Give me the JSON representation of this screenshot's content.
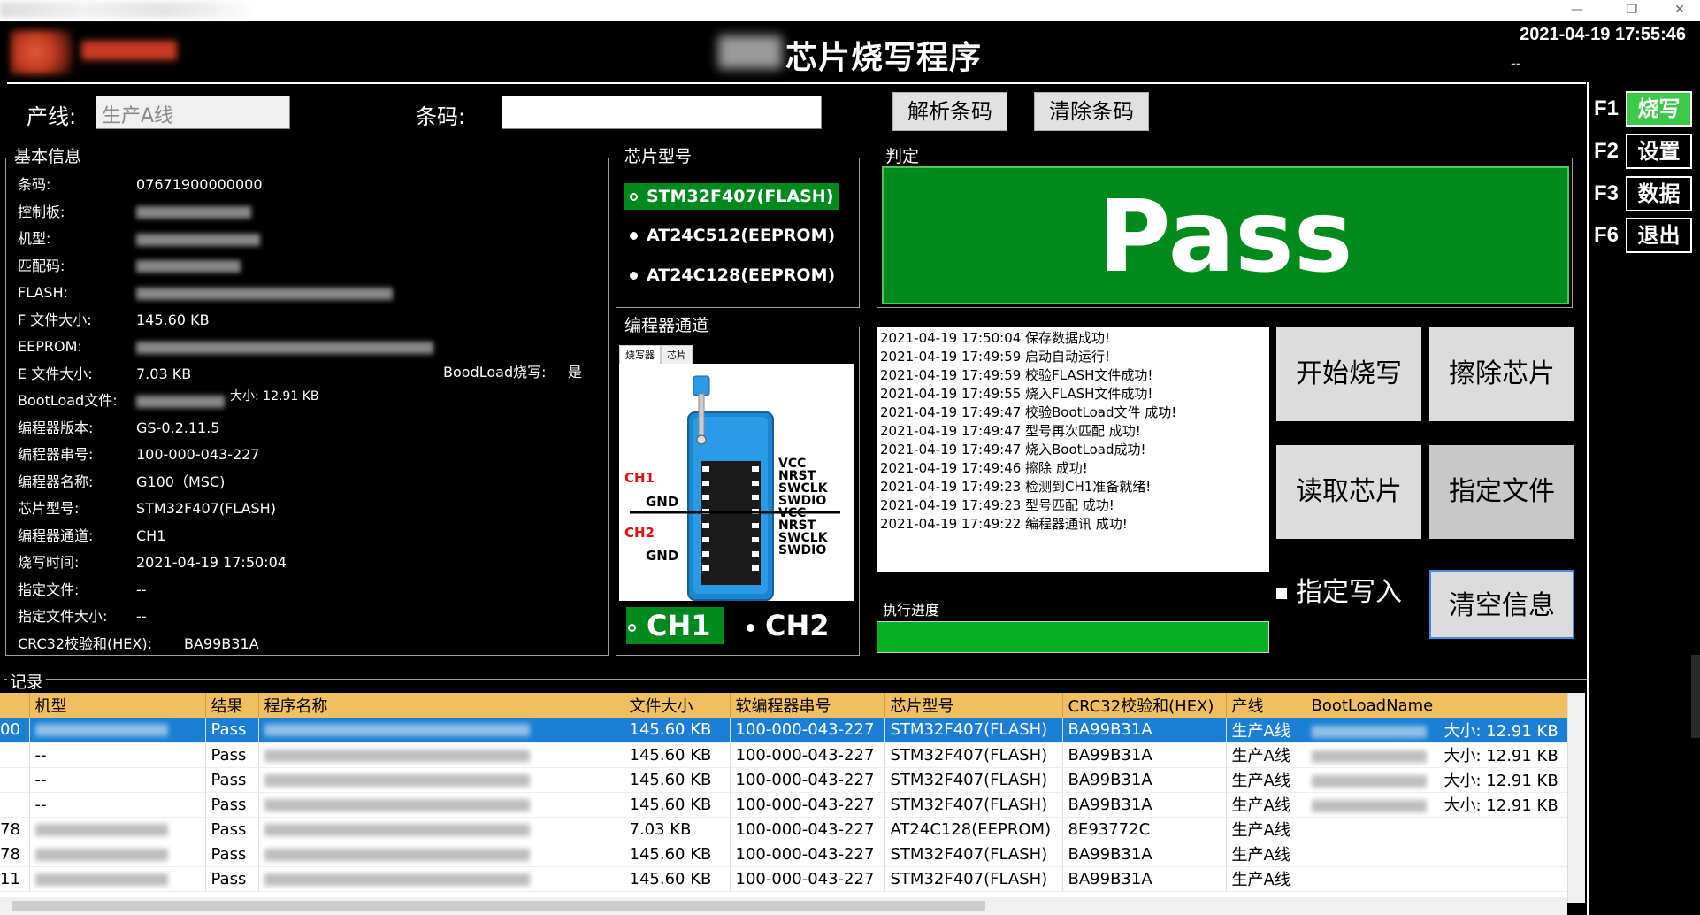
{
  "window": {
    "min": "—",
    "restore": "❐",
    "close": "✕"
  },
  "header": {
    "title": "芯片烧写程序",
    "datetime": "2021-04-19 17:55:46",
    "sub": "--"
  },
  "toolbar": {
    "line_label": "产线:",
    "line_value": "生产A线",
    "barcode_label": "条码:",
    "barcode_value": "",
    "parse_btn": "解析条码",
    "clear_btn": "清除条码"
  },
  "basic_info": {
    "title": "基本信息",
    "rows": [
      {
        "k": "条码:",
        "v": "07671900000000"
      },
      {
        "k": "控制板:",
        "v": ""
      },
      {
        "k": "机型:",
        "v": ""
      },
      {
        "k": "匹配码:",
        "v": ""
      },
      {
        "k": "FLASH:",
        "v": ""
      },
      {
        "k": "F 文件大小:",
        "v": "145.60 KB"
      },
      {
        "k": "EEPROM:",
        "v": ""
      },
      {
        "k": "E 文件大小:",
        "v": "7.03 KB"
      },
      {
        "k": "BootLoad文件:",
        "v": ""
      },
      {
        "k": "编程器版本:",
        "v": "GS-0.2.11.5"
      },
      {
        "k": "编程器串号:",
        "v": "100-000-043-227"
      },
      {
        "k": "编程器名称:",
        "v": "G100（MSC)"
      },
      {
        "k": "芯片型号:",
        "v": "STM32F407(FLASH)"
      },
      {
        "k": "编程器通道:",
        "v": "CH1"
      },
      {
        "k": "烧写时间:",
        "v": "2021-04-19 17:50:04"
      },
      {
        "k": "指定文件:",
        "v": "--"
      },
      {
        "k": "指定文件大小:",
        "v": "--"
      },
      {
        "k": "CRC32校验和(HEX):",
        "v": "BA99B31A"
      }
    ],
    "bootload_burn_label": "BoodLoad烧写:",
    "bootload_burn_value": "是",
    "bootload_size": "大小: 12.91 KB"
  },
  "chip_model": {
    "title": "芯片型号",
    "options": [
      "STM32F407(FLASH)",
      "AT24C512(EEPROM)",
      "AT24C128(EEPROM)"
    ]
  },
  "programmer_channel": {
    "title": "编程器通道",
    "tab1": "烧写器",
    "tab2": "芯片",
    "ch1": "CH1",
    "ch2": "CH2",
    "pins": [
      "VCC",
      "NRST",
      "SWCLK",
      "SWDIO",
      "VCC",
      "NRST",
      "SWCLK",
      "SWDIO"
    ],
    "gnd": "GND",
    "label_ch1": "CH1",
    "label_ch2": "CH2"
  },
  "judge": {
    "title": "判定",
    "result": "Pass"
  },
  "log": [
    {
      "t": "2021-04-19 17:50:04",
      "m": "保存数据成功!"
    },
    {
      "t": "2021-04-19 17:49:59",
      "m": "启动自动运行!"
    },
    {
      "t": "2021-04-19 17:49:59",
      "m": "校验FLASH文件成功!"
    },
    {
      "t": "2021-04-19 17:49:55",
      "m": "烧入FLASH文件成功!"
    },
    {
      "t": "2021-04-19 17:49:47",
      "m": "校验BootLoad文件 成功!"
    },
    {
      "t": "2021-04-19 17:49:47",
      "m": "型号再次匹配 成功!"
    },
    {
      "t": "2021-04-19 17:49:47",
      "m": "烧入BootLoad成功!"
    },
    {
      "t": "2021-04-19 17:49:46",
      "m": "擦除 成功!"
    },
    {
      "t": "2021-04-19 17:49:23",
      "m": "检测到CH1准备就绪!"
    },
    {
      "t": "2021-04-19 17:49:23",
      "m": "型号匹配 成功!"
    },
    {
      "t": "2021-04-19 17:49:22",
      "m": "编程器通讯 成功!"
    }
  ],
  "actions": {
    "start": "开始烧写",
    "erase": "擦除芯片",
    "read": "读取芯片",
    "assign_file": "指定文件",
    "assign_write": "指定写入",
    "clear_info": "清空信息"
  },
  "progress": {
    "label": "执行进度",
    "value": 1.0
  },
  "side_menu": [
    {
      "key": "F1",
      "label": "烧写"
    },
    {
      "key": "F2",
      "label": "设置"
    },
    {
      "key": "F3",
      "label": "数据"
    },
    {
      "key": "F6",
      "label": "退出"
    }
  ],
  "records": {
    "title": "记录",
    "columns": [
      "",
      "机型",
      "结果",
      "程序名称",
      "文件大小",
      "软编程器串号",
      "芯片型号",
      "CRC32校验和(HEX)",
      "产线",
      "BootLoadName"
    ],
    "rows": [
      [
        "00",
        "",
        "Pass",
        "",
        "145.60 KB",
        "100-000-043-227",
        "STM32F407(FLASH)",
        "BA99B31A",
        "生产A线",
        "大小: 12.91 KB"
      ],
      [
        "",
        "--",
        "Pass",
        "",
        "145.60 KB",
        "100-000-043-227",
        "STM32F407(FLASH)",
        "BA99B31A",
        "生产A线",
        "大小: 12.91 KB"
      ],
      [
        "",
        "--",
        "Pass",
        "",
        "145.60 KB",
        "100-000-043-227",
        "STM32F407(FLASH)",
        "BA99B31A",
        "生产A线",
        "大小: 12.91 KB"
      ],
      [
        "",
        "--",
        "Pass",
        "",
        "145.60 KB",
        "100-000-043-227",
        "STM32F407(FLASH)",
        "BA99B31A",
        "生产A线",
        "大小: 12.91 KB"
      ],
      [
        "78",
        "",
        "Pass",
        "",
        "7.03 KB",
        "100-000-043-227",
        "AT24C128(EEPROM)",
        "8E93772C",
        "生产A线",
        ""
      ],
      [
        "78",
        "",
        "Pass",
        "",
        "145.60 KB",
        "100-000-043-227",
        "STM32F407(FLASH)",
        "BA99B31A",
        "生产A线",
        ""
      ],
      [
        "11",
        "",
        "Pass",
        "",
        "145.60 KB",
        "100-000-043-227",
        "STM32F407(FLASH)",
        "BA99B31A",
        "生产A线",
        ""
      ]
    ]
  },
  "colors": {
    "pass_green": "#008a1e",
    "active_menu": "#3cc94a",
    "header_row": "#f0c060",
    "selected_row": "#1c7fd6"
  }
}
